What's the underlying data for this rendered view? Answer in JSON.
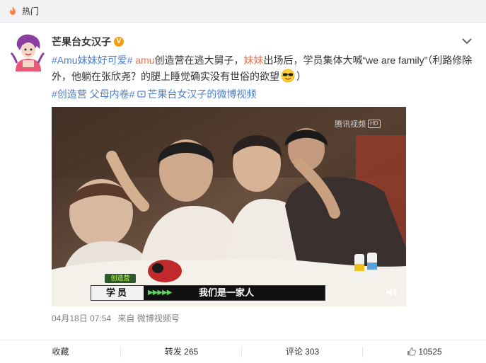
{
  "header": {
    "label": "热门",
    "icon": "hot-icon"
  },
  "post": {
    "author": "芒果台女汉子",
    "badge": "V",
    "text": {
      "tag": "#Amu妹妹好可爱#",
      "hl1": "amu",
      "t1": "创造营在逃大舅子，",
      "hl2": "妹妹",
      "t2": "出场后，学员集体大喊“we are family”（利路修除外，他躺在张欣尧？的腿上睡觉确实没有世俗的欲望",
      "t3": "）"
    },
    "topics": {
      "topic1": "#创造营 父母内卷#",
      "link": "芒果台女汉子的微博视频"
    },
    "video": {
      "watermark": "腾讯视频",
      "watermark_hd": "HD",
      "show_tag": "创造营",
      "speaker": "学员",
      "subtitle": "我们是一家人"
    },
    "meta": {
      "time": "04月18日 07:54",
      "source": "来自 微博视频号"
    }
  },
  "actions": {
    "favorite": "收藏",
    "repost": "转发 265",
    "comment": "评论 303",
    "like": "10525"
  },
  "colors": {
    "link": "#4d7ec8",
    "highlight": "#eb7350",
    "badge": "#f49e14",
    "topbar_bg": "#f2f2f5"
  }
}
